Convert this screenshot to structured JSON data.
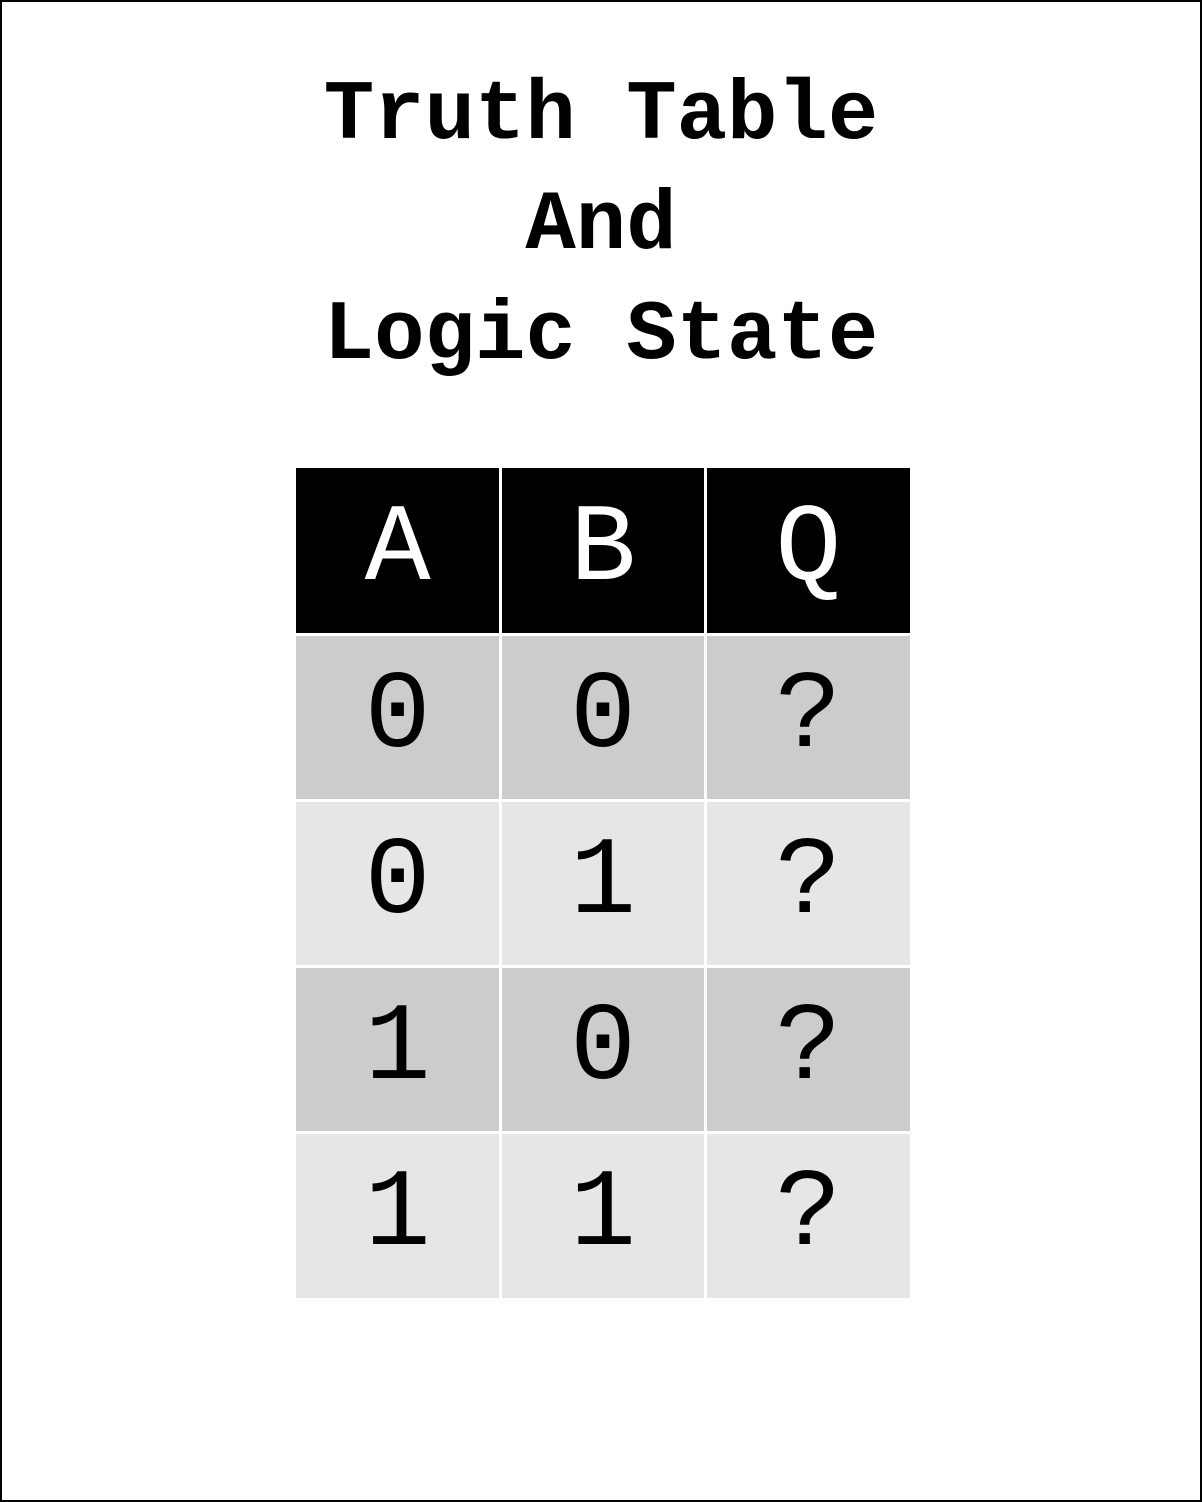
{
  "title": {
    "lines": [
      "Truth Table",
      "And",
      "Logic State"
    ]
  },
  "table": {
    "headers": [
      "A",
      "B",
      "Q"
    ],
    "rows": [
      [
        "0",
        "0",
        "?"
      ],
      [
        "0",
        "1",
        "?"
      ],
      [
        "1",
        "0",
        "?"
      ],
      [
        "1",
        "1",
        "?"
      ]
    ]
  },
  "colors": {
    "header_bg": "#000000",
    "header_text": "#ffffff",
    "row_odd_bg": "#cccccc",
    "row_even_bg": "#e6e6e6",
    "grid_line": "#ffffff"
  }
}
